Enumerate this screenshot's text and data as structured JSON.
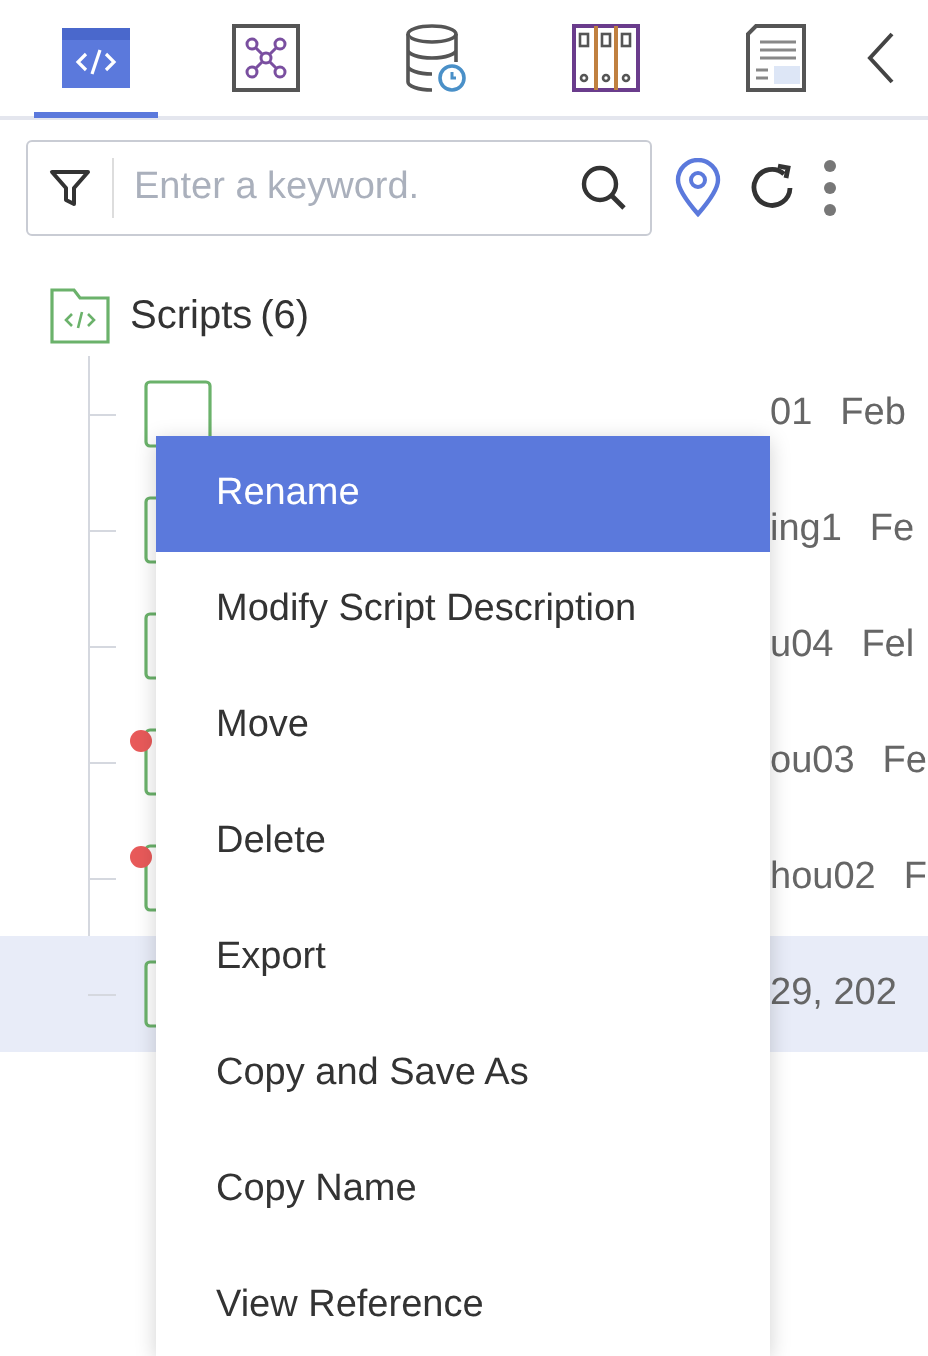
{
  "tabs": [
    {
      "kind": "code",
      "selected": true
    },
    {
      "kind": "graph",
      "selected": false
    },
    {
      "kind": "database",
      "selected": false
    },
    {
      "kind": "binders",
      "selected": false
    },
    {
      "kind": "log",
      "selected": false
    }
  ],
  "search": {
    "placeholder": "Enter a keyword."
  },
  "folder": {
    "label": "Scripts",
    "count": "(6)"
  },
  "rows": [
    {
      "texts": [
        "01",
        "Feb"
      ],
      "marked": false,
      "selected": false
    },
    {
      "texts": [
        "ing1",
        "Fe"
      ],
      "marked": false,
      "selected": false
    },
    {
      "texts": [
        "u04",
        "Fel"
      ],
      "marked": false,
      "selected": false
    },
    {
      "texts": [
        "ou03",
        "Fe"
      ],
      "marked": true,
      "selected": false
    },
    {
      "texts": [
        "hou02",
        "F"
      ],
      "marked": true,
      "selected": false
    },
    {
      "texts": [
        "29, 202"
      ],
      "marked": false,
      "selected": true
    }
  ],
  "menu": [
    {
      "label": "Rename",
      "selected": true
    },
    {
      "label": "Modify Script Description",
      "selected": false
    },
    {
      "label": "Move",
      "selected": false
    },
    {
      "label": "Delete",
      "selected": false
    },
    {
      "label": "Export",
      "selected": false
    },
    {
      "label": "Copy and Save As",
      "selected": false
    },
    {
      "label": "Copy Name",
      "selected": false
    },
    {
      "label": "View Reference",
      "selected": false
    }
  ]
}
